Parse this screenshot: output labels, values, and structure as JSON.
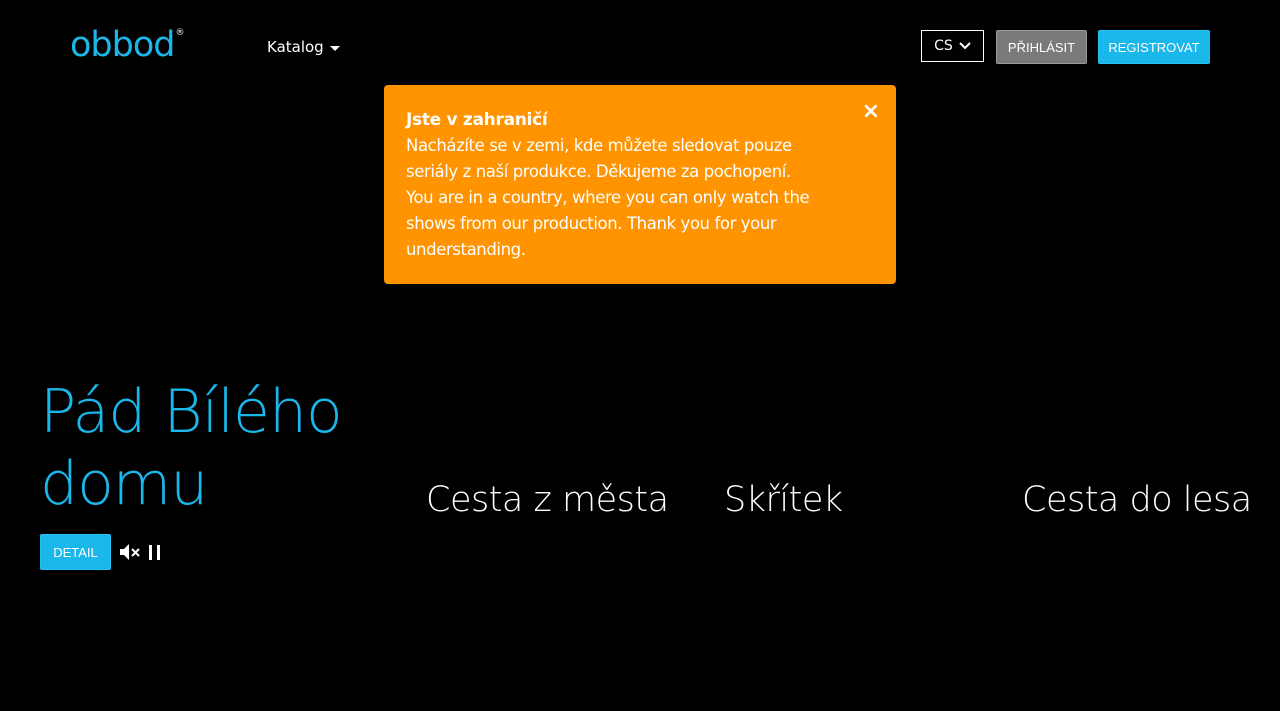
{
  "header": {
    "logo_text": "obbod",
    "logo_reg": "®",
    "catalog_label": "Katalog",
    "language": "CS",
    "login_label": "PŘIHLÁSIT",
    "register_label": "REGISTROVAT"
  },
  "alert": {
    "title": "Jste v zahraničí",
    "body": "Nacházíte se v zemi, kde můžete sledovat pouze\nseriály z naší produkce. Děkujeme za pochopení.\nYou are in a country, where you can only watch the\nshows from our production. Thank you for your\nunderstanding.",
    "close_symbol": "×",
    "background": "#ff9400"
  },
  "hero": {
    "title": "Pád Bílého domu",
    "detail_label": "DETAIL",
    "accent_color": "#1ab7ea"
  },
  "slides": [
    {
      "title": "Cesta z města"
    },
    {
      "title": "Skřítek"
    },
    {
      "title": "Cesta do lesa"
    }
  ],
  "icons": {
    "mute": "volume-mute-icon",
    "pause": "pause-icon",
    "chevron": "chevron-down-icon"
  }
}
